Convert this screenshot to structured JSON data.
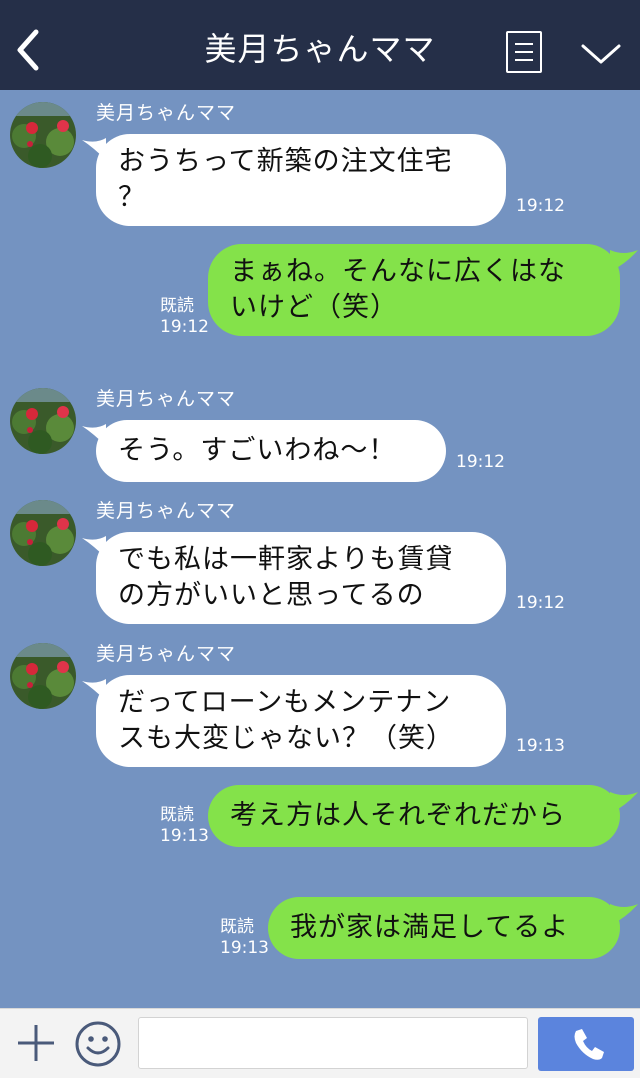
{
  "header": {
    "title": "美月ちゃんママ",
    "back_icon": "chevron-left-icon",
    "menu_icon": "menu-lines-icon",
    "dropdown_icon": "chevron-down-icon"
  },
  "colors": {
    "header_bg": "#252f48",
    "chat_bg": "#7493c1",
    "incoming_bubble": "#ffffff",
    "outgoing_bubble": "#84e24a",
    "call_button": "#5b84dd"
  },
  "messages": [
    {
      "direction": "in",
      "sender": "美月ちゃんママ",
      "lines": [
        "おうちって新築の注文住宅",
        "？"
      ],
      "time": "19:12"
    },
    {
      "direction": "out",
      "read": "既読",
      "lines": [
        "まぁね。そんなに広くはな",
        "いけど（笑）"
      ],
      "time": "19:12"
    },
    {
      "direction": "in",
      "sender": "美月ちゃんママ",
      "lines": [
        "そう。すごいわね〜！"
      ],
      "time": "19:12"
    },
    {
      "direction": "in",
      "sender": "美月ちゃんママ",
      "lines": [
        "でも私は一軒家よりも賃貸",
        "の方がいいと思ってるの"
      ],
      "time": "19:12"
    },
    {
      "direction": "in",
      "sender": "美月ちゃんママ",
      "lines": [
        "だってローンもメンテナン",
        "スも大変じゃない？（笑）"
      ],
      "time": "19:13"
    },
    {
      "direction": "out",
      "read": "既読",
      "lines": [
        "考え方は人それぞれだから"
      ],
      "time": "19:13"
    },
    {
      "direction": "out",
      "read": "既読",
      "lines": [
        "我が家は満足してるよ"
      ],
      "time": "19:13"
    }
  ],
  "input_bar": {
    "plus_icon": "plus-icon",
    "emoji_icon": "smiley-icon",
    "input_value": "",
    "call_icon": "phone-icon"
  }
}
